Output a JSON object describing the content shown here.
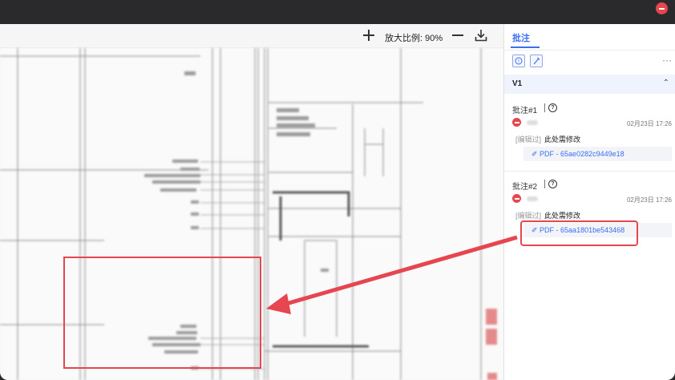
{
  "window": {
    "close_icon": "close-icon"
  },
  "toolbar": {
    "zoom_label": "放大比例: 90%",
    "zoom_in_icon": "plus-icon",
    "zoom_out_icon": "minus-icon",
    "download_icon": "download-icon"
  },
  "panel": {
    "tab_label": "批注",
    "more_icon": "···",
    "version_label": "V1",
    "version_chevron": "⌃",
    "annotations": [
      {
        "title": "批注#1",
        "date": "02月23日 17:26",
        "edited": "[编辑过]",
        "text": "此处需修改",
        "link": "PDF - 65ae0282c9449e18"
      },
      {
        "title": "批注#2",
        "date": "02月23日 17:26",
        "edited": "[编辑过]",
        "text": "此处需修改",
        "link": "PDF - 65aa1801be543468"
      }
    ]
  },
  "colors": {
    "accent": "#3b6ef0",
    "highlight_red": "#e5464f"
  }
}
